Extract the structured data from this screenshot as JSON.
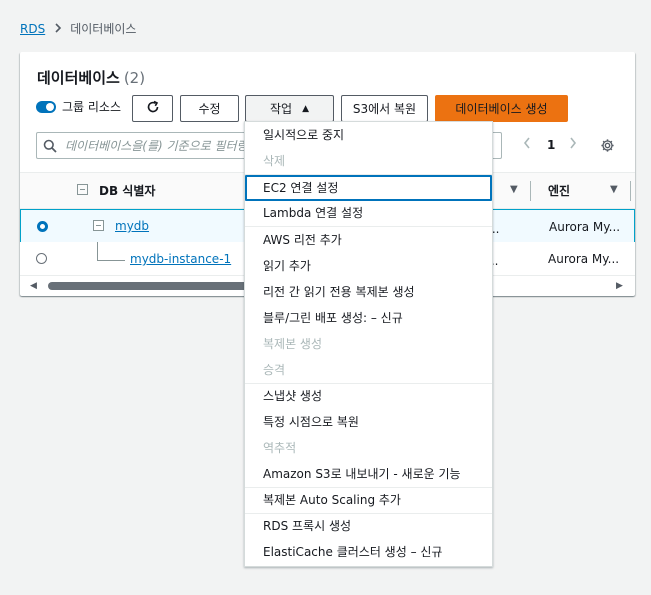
{
  "breadcrumb": {
    "root": "RDS",
    "current": "데이터베이스"
  },
  "panel": {
    "title": "데이터베이스",
    "count": "(2)"
  },
  "toolbar": {
    "group_label": "그룹 리소스",
    "modify": "수정",
    "actions": "작업",
    "restore_s3": "S3에서 복원",
    "create_db": "데이터베이스 생성"
  },
  "search": {
    "placeholder": "데이터베이스을(를) 기준으로 필터링"
  },
  "pagination": {
    "page": "1"
  },
  "table": {
    "headers": {
      "db_identifier": "DB 식별자",
      "engine": "엔진"
    },
    "rows": [
      {
        "name": "mydb",
        "trunc": "어...",
        "engine": "Aurora My..."
      },
      {
        "name": "mydb-instance-1",
        "trunc": "인...",
        "engine": "Aurora My..."
      }
    ]
  },
  "menu": {
    "items": [
      {
        "label": "일시적으로 중지"
      },
      {
        "label": "삭제"
      },
      {
        "label": "EC2 연결 설정"
      },
      {
        "label": "Lambda 연결 설정"
      },
      {
        "label": "AWS 리전 추가"
      },
      {
        "label": "읽기 추가"
      },
      {
        "label": "리전 간 읽기 전용 복제본 생성"
      },
      {
        "label": "블루/그린 배포 생성: – 신규"
      },
      {
        "label": "복제본 생성"
      },
      {
        "label": "승격"
      },
      {
        "label": "스냅샷 생성"
      },
      {
        "label": "특정 시점으로 복원"
      },
      {
        "label": "역추적"
      },
      {
        "label": "Amazon S3로 내보내기 - 새로운 기능"
      },
      {
        "label": "복제본 Auto Scaling 추가"
      },
      {
        "label": "RDS 프록시 생성"
      },
      {
        "label": "ElastiCache 클러스터 생성 – 신규"
      }
    ]
  },
  "colors": {
    "accent": "#0073bb",
    "primary_button": "#ec7211",
    "disabled_text": "#aab7b8"
  },
  "icons": {
    "refresh": "refresh-icon",
    "search": "search-icon",
    "settings": "gear-icon"
  }
}
